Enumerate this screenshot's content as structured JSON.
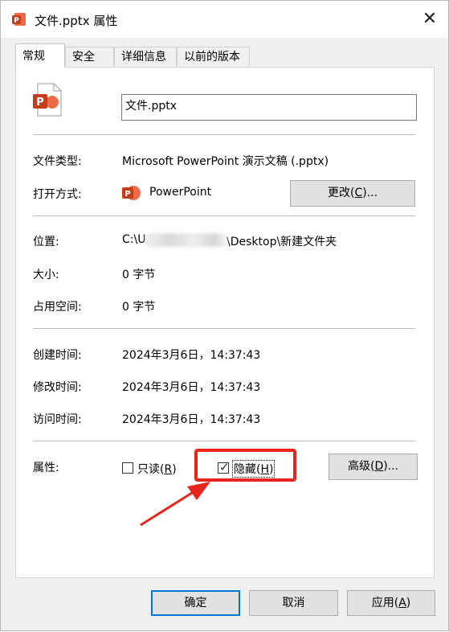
{
  "window": {
    "title": "文件.pptx 属性",
    "close_glyph": "✕"
  },
  "tabs": [
    "常规",
    "安全",
    "详细信息",
    "以前的版本"
  ],
  "general": {
    "file_name": "文件.pptx",
    "file_type": {
      "label": "文件类型:",
      "value": "Microsoft PowerPoint 演示文稿 (.pptx)"
    },
    "open_with": {
      "label": "打开方式:",
      "app": "PowerPoint",
      "change_text": "更改(",
      "change_key": "C",
      "change_tail": ")..."
    },
    "location": {
      "label": "位置:",
      "prefix": "C:\\U",
      "suffix": "\\Desktop\\新建文件夹"
    },
    "size": {
      "label": "大小:",
      "value": "0 字节"
    },
    "size_on_disk": {
      "label": "占用空间:",
      "value": "0 字节"
    },
    "created": {
      "label": "创建时间:",
      "value": "2024年3月6日，14:37:43"
    },
    "modified": {
      "label": "修改时间:",
      "value": "2024年3月6日，14:37:43"
    },
    "accessed": {
      "label": "访问时间:",
      "value": "2024年3月6日，14:37:43"
    },
    "attributes": {
      "label": "属性:",
      "readonly": {
        "text": "只读(",
        "key": "R",
        "tail": ")",
        "checked": false
      },
      "hidden": {
        "text": "隐藏(",
        "key": "H",
        "tail": ")",
        "checked": true
      },
      "advanced": {
        "text": "高级(",
        "key": "D",
        "tail": ")..."
      }
    }
  },
  "footer": {
    "ok": "确定",
    "cancel": "取消",
    "apply_text": "应用(",
    "apply_key": "A",
    "apply_tail": ")"
  },
  "colors": {
    "highlight": "#e8251b",
    "powerpoint": "#d35230",
    "focus_border": "#0078d7"
  }
}
